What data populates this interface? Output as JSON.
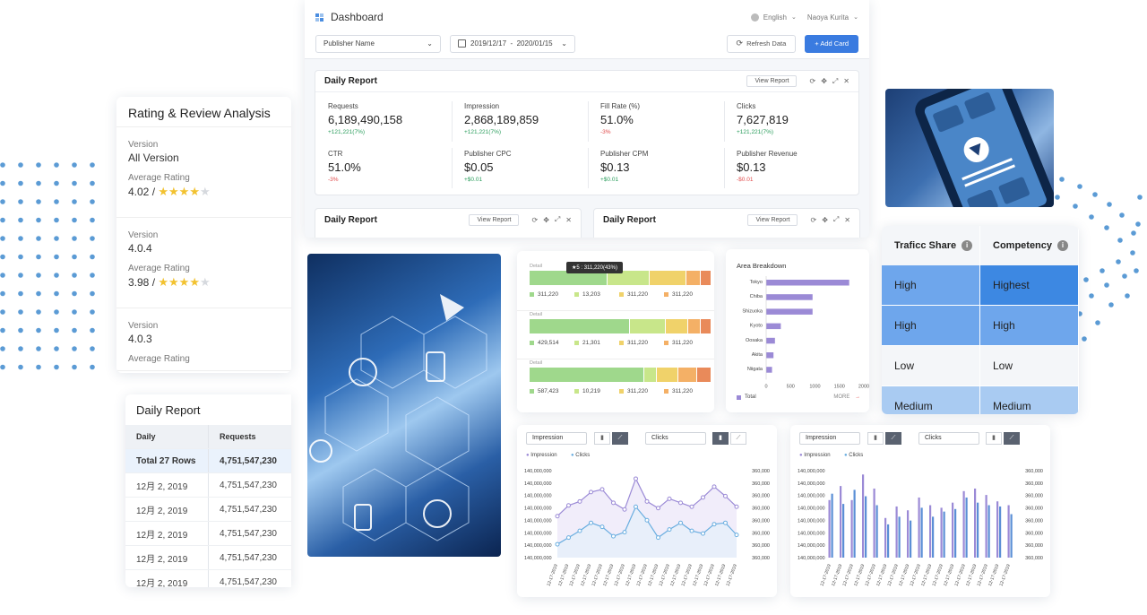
{
  "colors": {
    "accent": "#3a7be0",
    "dots": "#5b9bd5",
    "purple": "#9b8ad6",
    "blue_line": "#6aaee0"
  },
  "dashboard": {
    "title": "Dashboard",
    "language": "English",
    "user": "Naoya Kurita",
    "publisher_select": "Publisher Name",
    "date_range": "2019/12/17  -  2020/01/15",
    "refresh_label": "Refresh Data",
    "add_card_label": "+ Add Card",
    "report": {
      "title": "Daily Report",
      "view_label": "View Report",
      "metrics": [
        {
          "label": "Requests",
          "value": "6,189,490,158",
          "change": "+121,221(7%)",
          "dir": "up"
        },
        {
          "label": "Impression",
          "value": "2,868,189,859",
          "change": "+121,221(7%)",
          "dir": "up"
        },
        {
          "label": "Fill Rate (%)",
          "value": "51.0%",
          "change": "-3%",
          "dir": "down"
        },
        {
          "label": "Clicks",
          "value": "7,627,819",
          "change": "+121,221(7%)",
          "dir": "up"
        },
        {
          "label": "CTR",
          "value": "51.0%",
          "change": "-3%",
          "dir": "down"
        },
        {
          "label": "Publisher CPC",
          "value": "$0.05",
          "change": "+$0.01",
          "dir": "up"
        },
        {
          "label": "Publisher CPM",
          "value": "$0.13",
          "change": "+$0.01",
          "dir": "up"
        },
        {
          "label": "Publisher Revenue",
          "value": "$0.13",
          "change": "-$0.01",
          "dir": "down"
        }
      ]
    },
    "sub_reports": [
      {
        "title": "Daily Report",
        "view_label": "View Report"
      },
      {
        "title": "Daily Report",
        "view_label": "View Report"
      }
    ]
  },
  "rating": {
    "title": "Rating & Review Analysis",
    "sections": [
      {
        "version_label": "Version",
        "version": "All Version",
        "avg_label": "Average Rating",
        "avg": "4.02 /",
        "stars": 4
      },
      {
        "version_label": "Version",
        "version": "4.0.4",
        "avg_label": "Average Rating",
        "avg": "3.98 /",
        "stars": 4
      },
      {
        "version_label": "Version",
        "version": "4.0.3",
        "avg_label": "Average Rating",
        "avg": "",
        "stars": 0
      }
    ]
  },
  "daily_table": {
    "title": "Daily Report",
    "headers": [
      "Daily",
      "Requests"
    ],
    "rows": [
      [
        "Total 27 Rows",
        "4,751,547,230"
      ],
      [
        "12月 2, 2019",
        "4,751,547,230"
      ],
      [
        "12月 2, 2019",
        "4,751,547,230"
      ],
      [
        "12月 2, 2019",
        "4,751,547,230"
      ],
      [
        "12月 2, 2019",
        "4,751,547,230"
      ],
      [
        "12月 2, 2019",
        "4,751,547,230"
      ]
    ]
  },
  "stacked": {
    "tooltip": "★5 : 311,220(43%)",
    "detail_label": "Detail",
    "rows": [
      {
        "segments": [
          0.43,
          0.23,
          0.2,
          0.08,
          0.06
        ],
        "legend": [
          "311,220",
          "13,203",
          "311,220",
          "311,220"
        ]
      },
      {
        "segments": [
          0.55,
          0.2,
          0.12,
          0.07,
          0.06
        ],
        "legend": [
          "429,514",
          "21,301",
          "311,220",
          "311,220"
        ]
      },
      {
        "segments": [
          0.63,
          0.07,
          0.12,
          0.1,
          0.08
        ],
        "legend": [
          "587,423",
          "10,219",
          "311,220",
          "311,220"
        ]
      }
    ],
    "seg_colors": [
      "#9fd88c",
      "#c8e68a",
      "#f0d26a",
      "#f4b066",
      "#e98a5a"
    ]
  },
  "area_breakdown": {
    "title": "Area Breakdown",
    "more_label": "MORE",
    "legend": "Total"
  },
  "traffic": {
    "headers": [
      "Traficc Share",
      "Competency"
    ],
    "rows": [
      [
        "High",
        "Highest"
      ],
      [
        "High",
        "High"
      ],
      [
        "Low",
        "Low"
      ],
      [
        "Medium",
        "Medium"
      ]
    ],
    "row_colors": [
      [
        "#6ea6ec",
        "#3d88e2"
      ],
      [
        "#6ea6ec",
        "#6ea6ec"
      ],
      [
        "#f4f6f9",
        "#f4f6f9"
      ],
      [
        "#a9cbf2",
        "#a9cbf2"
      ]
    ]
  },
  "line_charts": [
    {
      "select1": "Impression",
      "select2": "Clicks",
      "legend": [
        "Impression",
        "Clicks"
      ]
    },
    {
      "select1": "Impression",
      "select2": "Clicks",
      "legend": [
        "Impression",
        "Clicks"
      ]
    }
  ],
  "chart_data": [
    {
      "type": "bar",
      "title": "Area Breakdown",
      "categories": [
        "Tokyo",
        "Chiba",
        "Shizuoka",
        "Kyoto",
        "Oosaka",
        "Akita",
        "Niigata"
      ],
      "series": [
        {
          "name": "Total",
          "values": [
            1700,
            950,
            950,
            300,
            180,
            150,
            120
          ]
        }
      ],
      "xlim": [
        0,
        2000
      ],
      "xticks": [
        "0",
        "500",
        "1000",
        "1500",
        "2000"
      ]
    },
    {
      "type": "line",
      "x": [
        "12-17-2019",
        "12-17-2019",
        "12-17-2019",
        "12-17-2019",
        "12-17-2019",
        "12-17-2019",
        "12-17-2019",
        "12-17-2019",
        "12-17-2019",
        "12-17-2019",
        "12-17-2019",
        "12-17-2019",
        "12-17-2019",
        "12-17-2019",
        "12-17-2019",
        "12-17-2019",
        "12-17-2019"
      ],
      "yticks_left": [
        "140,000,000",
        "140,000,000",
        "140,000,000",
        "140,000,000",
        "140,000,000",
        "140,000,000",
        "140,000,000",
        "140,000,000"
      ],
      "yticks_right": [
        "360,000",
        "360,000",
        "360,000",
        "360,000",
        "360,000",
        "360,000",
        "360,000",
        "360,000"
      ],
      "series": [
        {
          "name": "Impression",
          "values": [
            3.1,
            3.9,
            4.2,
            4.9,
            5.1,
            4.1,
            3.6,
            5.9,
            4.2,
            3.7,
            4.4,
            4.1,
            3.8,
            4.5,
            5.3,
            4.6,
            3.8
          ]
        },
        {
          "name": "Clicks",
          "values": [
            1.0,
            1.5,
            2.0,
            2.6,
            2.3,
            1.6,
            1.9,
            3.8,
            2.8,
            1.5,
            2.1,
            2.6,
            2.0,
            1.8,
            2.5,
            2.6,
            1.7
          ]
        }
      ]
    },
    {
      "type": "bar",
      "x": [
        "12-17-2019",
        "12-17-2019",
        "12-17-2019",
        "12-17-2019",
        "12-17-2019",
        "12-17-2019",
        "12-17-2019",
        "12-17-2019",
        "12-17-2019",
        "12-17-2019",
        "12-17-2019",
        "12-17-2019",
        "12-17-2019",
        "12-17-2019",
        "12-17-2019",
        "12-17-2019",
        "12-17-2019"
      ],
      "yticks_left": [
        "140,000,000",
        "140,000,000",
        "140,000,000",
        "140,000,000",
        "140,000,000",
        "140,000,000",
        "140,000,000",
        "140,000,000"
      ],
      "yticks_right": [
        "360,000",
        "360,000",
        "360,000",
        "360,000",
        "360,000",
        "360,000",
        "360,000",
        "360,000"
      ],
      "series": [
        {
          "name": "Impression",
          "values": [
            4.5,
            5.6,
            4.5,
            6.5,
            5.4,
            3.1,
            4.0,
            3.7,
            4.7,
            4.1,
            3.9,
            4.3,
            5.2,
            5.4,
            4.9,
            4.4,
            4.1
          ]
        },
        {
          "name": "Clicks",
          "values": [
            5.0,
            4.2,
            5.3,
            4.8,
            4.1,
            2.6,
            3.2,
            2.9,
            3.9,
            3.2,
            3.6,
            3.8,
            4.7,
            4.3,
            4.1,
            4.0,
            3.4
          ]
        }
      ]
    }
  ]
}
